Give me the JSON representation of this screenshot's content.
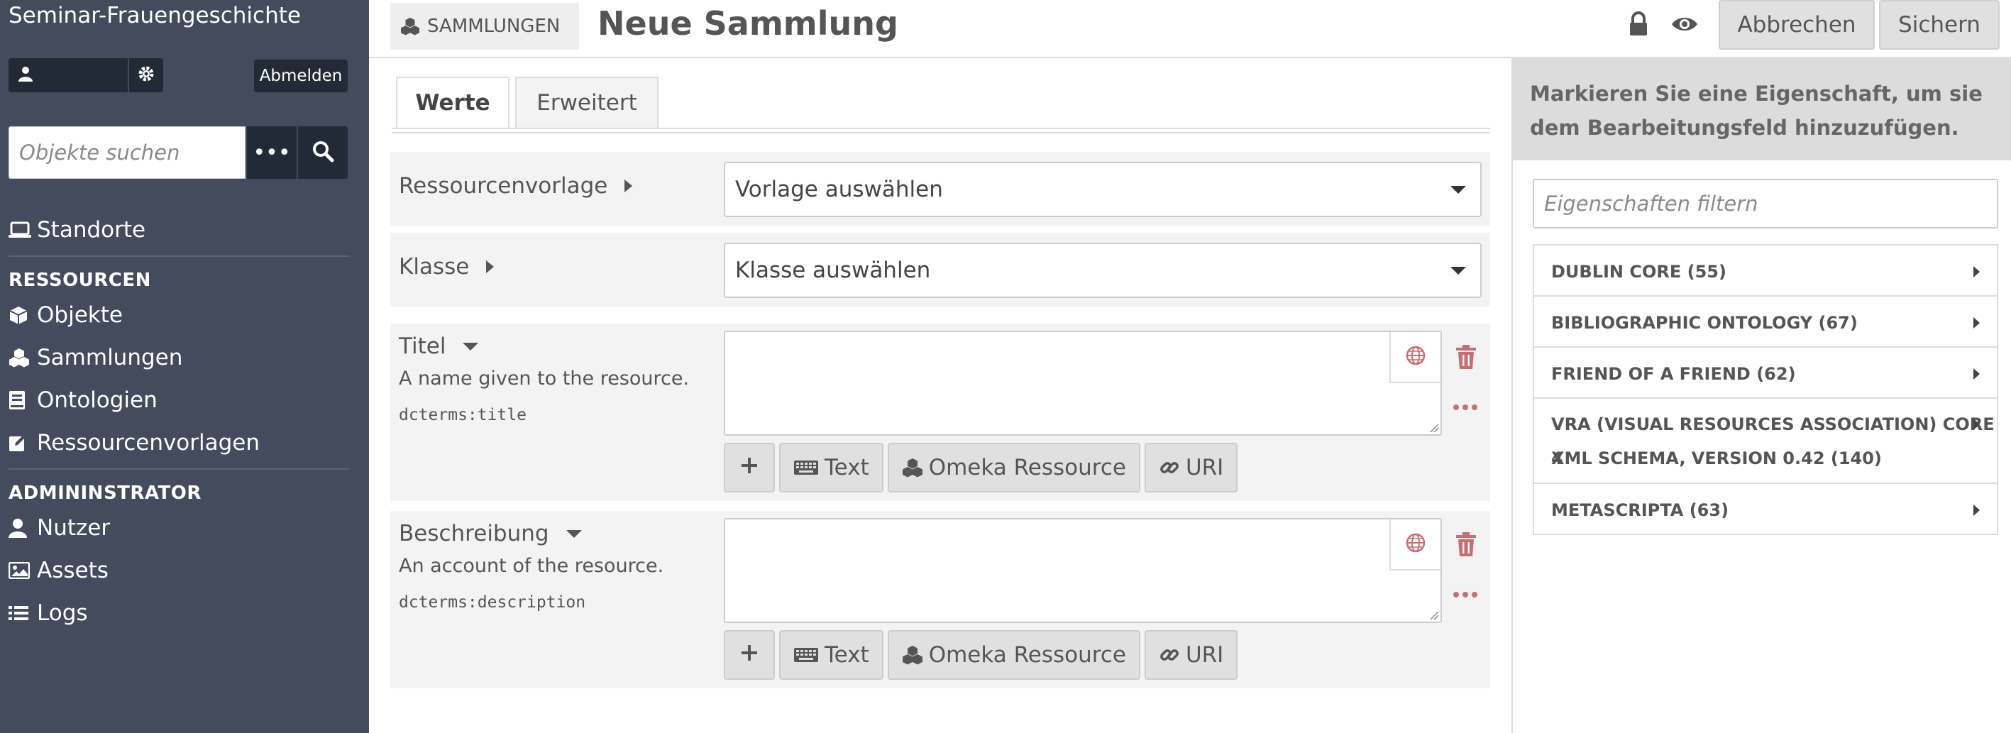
{
  "sidebar": {
    "site_title": "Seminar-Frauengeschichte",
    "logout_label": "Abmelden",
    "search_placeholder": "Objekte suchen",
    "search_more": "•••",
    "nav_top": [
      {
        "label": "Standorte",
        "icon": "laptop-icon"
      }
    ],
    "resources_heading": "RESSOURCEN",
    "resources": [
      {
        "label": "Objekte",
        "icon": "cube-icon"
      },
      {
        "label": "Sammlungen",
        "icon": "cubes-icon",
        "active": true
      },
      {
        "label": "Ontologien",
        "icon": "book-icon"
      },
      {
        "label": "Ressourcenvorlagen",
        "icon": "pencil-square-icon"
      }
    ],
    "admin_heading": "ADMININSTRATOR",
    "admin": [
      {
        "label": "Nutzer",
        "icon": "user-icon"
      },
      {
        "label": "Assets",
        "icon": "image-icon"
      },
      {
        "label": "Logs",
        "icon": "list-icon"
      }
    ]
  },
  "header": {
    "section_label": "SAMMLUNGEN",
    "title": "Neue Sammlung",
    "cancel_label": "Abbrechen",
    "save_label": "Sichern"
  },
  "tabs": [
    {
      "label": "Werte",
      "active": true
    },
    {
      "label": "Erweitert",
      "active": false
    }
  ],
  "form": {
    "template_label": "Ressourcenvorlage",
    "template_value": "Vorlage auswählen",
    "class_label": "Klasse",
    "class_value": "Klasse auswählen",
    "properties": [
      {
        "label": "Titel",
        "comment": "A name given to the resource.",
        "term": "dcterms:title"
      },
      {
        "label": "Beschreibung",
        "comment": "An account of the resource.",
        "term": "dcterms:description"
      }
    ],
    "value_buttons": {
      "text": "Text",
      "resource": "Omeka Ressource",
      "uri": "URI"
    }
  },
  "properties_panel": {
    "instruction": "Markieren Sie eine Eigenschaft, um sie dem Bearbeitungsfeld hinzuzufügen.",
    "filter_placeholder": "Eigenschaften filtern",
    "vocabularies": [
      {
        "label_line1": "DUBLIN CORE (55)",
        "label_line2": ""
      },
      {
        "label_line1": "BIBLIOGRAPHIC ONTOLOGY (67)",
        "label_line2": ""
      },
      {
        "label_line1": "FRIEND OF A FRIEND (62)",
        "label_line2": ""
      },
      {
        "label_line1": "VRA (VISUAL RESOURCES ASSOCIATION) CORE 4",
        "label_line2": "XML SCHEMA, VERSION 0.42 (140)"
      },
      {
        "label_line1": "METASCRIPTA (63)",
        "label_line2": ""
      }
    ]
  },
  "colors": {
    "sidebar_bg": "#434b5c",
    "sidebar_dark": "#222a36",
    "danger": "#c76e6e"
  }
}
